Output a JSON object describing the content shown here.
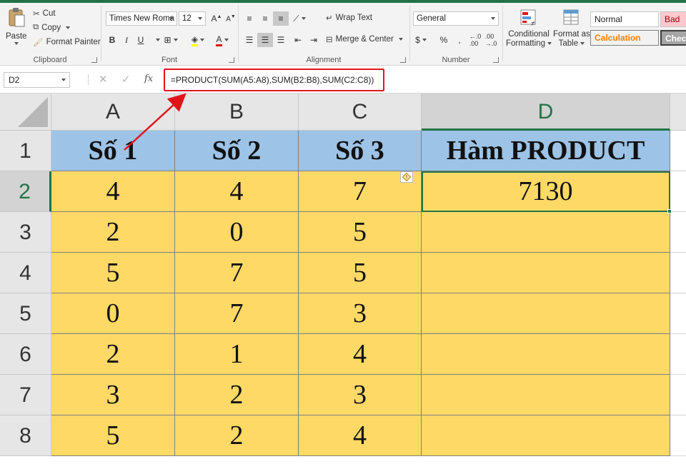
{
  "ribbon": {
    "clipboard": {
      "paste": "Paste",
      "cut": "Cut",
      "copy": "Copy",
      "format_painter": "Format Painter",
      "label": "Clipboard"
    },
    "font": {
      "name": "Times New Roma",
      "size": "12",
      "bold": "B",
      "italic": "I",
      "underline": "U",
      "label": "Font"
    },
    "alignment": {
      "wrap_text": "Wrap Text",
      "merge_center": "Merge & Center",
      "label": "Alignment"
    },
    "number": {
      "format": "General",
      "currency": "$",
      "percent": "%",
      "comma": ",",
      "label": "Number"
    },
    "styles": {
      "conditional_formatting_line1": "Conditional",
      "conditional_formatting_line2": "Formatting",
      "format_as_table_line1": "Format as",
      "format_as_table_line2": "Table",
      "normal": "Normal",
      "bad": "Bad",
      "calculation": "Calculation",
      "check": "Check"
    }
  },
  "formula_bar": {
    "name_box": "D2",
    "fx": "fx",
    "formula": "=PRODUCT(SUM(A5:A8),SUM(B2:B8),SUM(C2:C8))"
  },
  "sheet": {
    "columns": [
      "A",
      "B",
      "C",
      "D"
    ],
    "rows": [
      "1",
      "2",
      "3",
      "4",
      "5",
      "6",
      "7",
      "8"
    ],
    "header_row": [
      "Số 1",
      "Số 2",
      "Số 3",
      "Hàm PRODUCT"
    ],
    "data_rows": [
      [
        "4",
        "4",
        "7",
        "7130"
      ],
      [
        "2",
        "0",
        "5",
        ""
      ],
      [
        "5",
        "7",
        "5",
        ""
      ],
      [
        "0",
        "7",
        "3",
        ""
      ],
      [
        "2",
        "1",
        "4",
        ""
      ],
      [
        "3",
        "2",
        "3",
        ""
      ],
      [
        "5",
        "2",
        "4",
        ""
      ]
    ],
    "active_cell": "D2"
  },
  "colors": {
    "header_fill": "#9dc3e6",
    "data_fill": "#ffd966",
    "excel_green": "#217346",
    "annotation_red": "#e0151a"
  }
}
